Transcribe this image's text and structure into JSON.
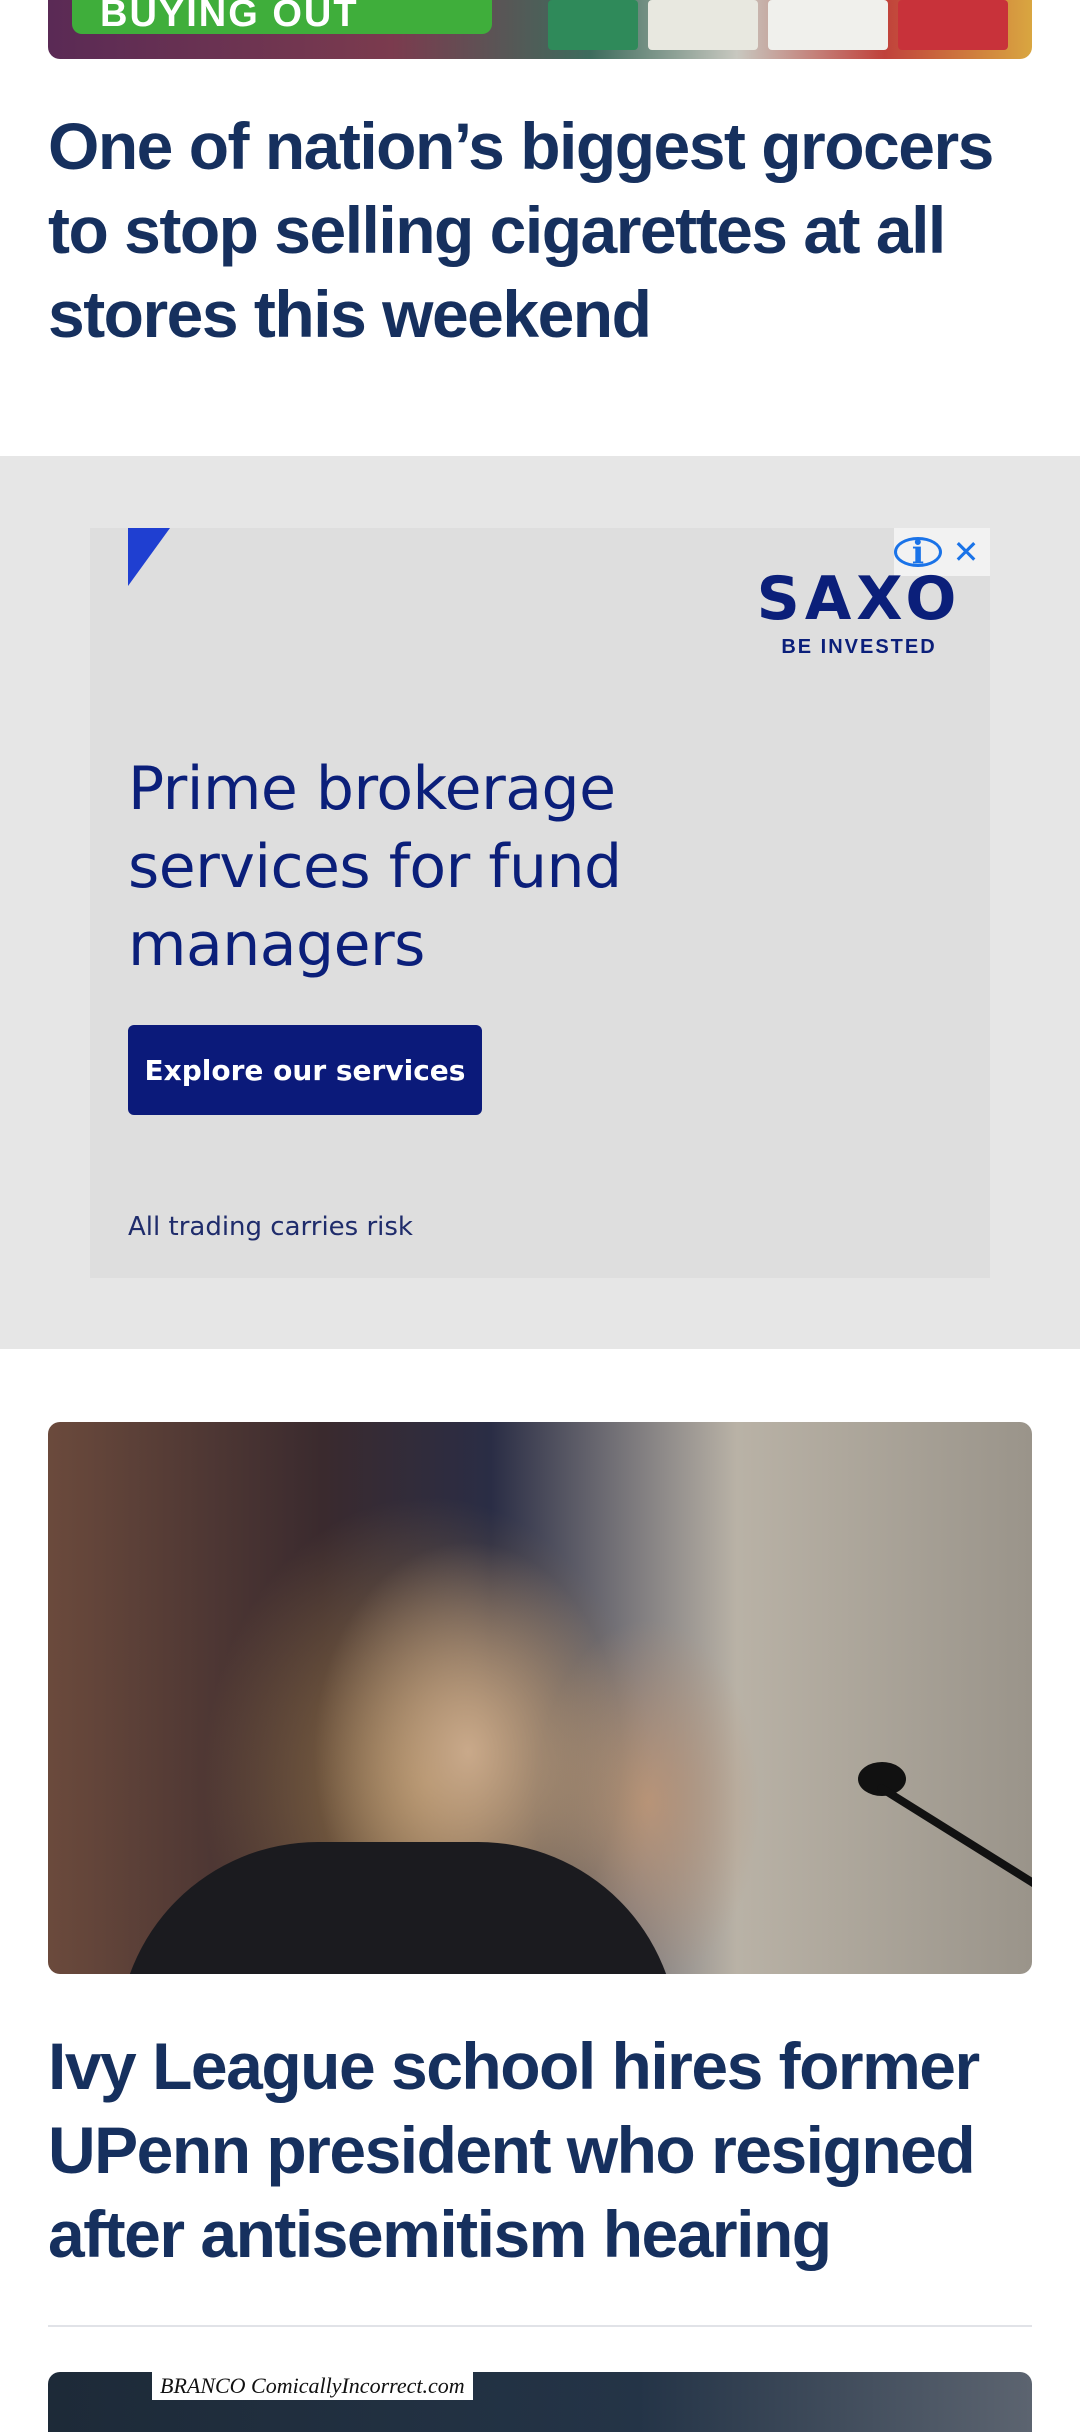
{
  "articles": [
    {
      "headline": "One of nation’s biggest grocers to stop selling cigarettes at all stores this weekend",
      "image_badge": "BUYING OUT"
    },
    {
      "headline": "Ivy League school hires former UPenn president who resigned after antisemitism hearing"
    },
    {
      "image_caption": "BRANCO ComicallyIncorrect.com"
    }
  ],
  "ad": {
    "brand": "SAXO",
    "tagline": "BE INVESTED",
    "heading": "Prime brokerage services for fund managers",
    "cta_label": "Explore our services",
    "disclaimer": "All trading carries risk",
    "info_icon": "info-icon",
    "close_icon": "close-icon",
    "close_glyph": "✕",
    "info_glyph": "i",
    "colors": {
      "brand_navy": "#0b1f7a",
      "accent_blue": "#1f3fd1",
      "ad_background": "#dedede"
    }
  },
  "colors": {
    "headline": "#16305e",
    "section_background": "#e6e6e6"
  }
}
